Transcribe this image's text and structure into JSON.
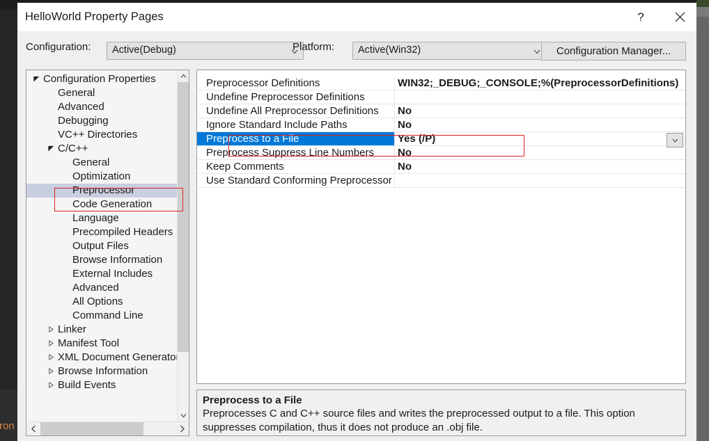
{
  "backdrop": {
    "edge_text": "ron"
  },
  "window": {
    "title": "HelloWorld Property Pages",
    "help_icon": "question-mark-icon",
    "close_icon": "close-icon"
  },
  "toolbar": {
    "configuration_label": "Configuration:",
    "configuration_value": "Active(Debug)",
    "platform_label": "Platform:",
    "platform_value": "Active(Win32)",
    "configuration_manager_label": "Configuration Manager...",
    "chevron_icon": "chevron-down-icon"
  },
  "tree": {
    "nodes": [
      {
        "label": "Configuration Properties",
        "indent": 0,
        "state": "expanded",
        "selected": false
      },
      {
        "label": "General",
        "indent": 1,
        "state": "leaf",
        "selected": false
      },
      {
        "label": "Advanced",
        "indent": 1,
        "state": "leaf",
        "selected": false
      },
      {
        "label": "Debugging",
        "indent": 1,
        "state": "leaf",
        "selected": false
      },
      {
        "label": "VC++ Directories",
        "indent": 1,
        "state": "leaf",
        "selected": false
      },
      {
        "label": "C/C++",
        "indent": 1,
        "state": "expanded",
        "selected": false
      },
      {
        "label": "General",
        "indent": 2,
        "state": "leaf",
        "selected": false
      },
      {
        "label": "Optimization",
        "indent": 2,
        "state": "leaf",
        "selected": false
      },
      {
        "label": "Preprocessor",
        "indent": 2,
        "state": "leaf",
        "selected": true
      },
      {
        "label": "Code Generation",
        "indent": 2,
        "state": "leaf",
        "selected": false
      },
      {
        "label": "Language",
        "indent": 2,
        "state": "leaf",
        "selected": false
      },
      {
        "label": "Precompiled Headers",
        "indent": 2,
        "state": "leaf",
        "selected": false
      },
      {
        "label": "Output Files",
        "indent": 2,
        "state": "leaf",
        "selected": false
      },
      {
        "label": "Browse Information",
        "indent": 2,
        "state": "leaf",
        "selected": false
      },
      {
        "label": "External Includes",
        "indent": 2,
        "state": "leaf",
        "selected": false
      },
      {
        "label": "Advanced",
        "indent": 2,
        "state": "leaf",
        "selected": false
      },
      {
        "label": "All Options",
        "indent": 2,
        "state": "leaf",
        "selected": false
      },
      {
        "label": "Command Line",
        "indent": 2,
        "state": "leaf",
        "selected": false
      },
      {
        "label": "Linker",
        "indent": 1,
        "state": "collapsed",
        "selected": false
      },
      {
        "label": "Manifest Tool",
        "indent": 1,
        "state": "collapsed",
        "selected": false
      },
      {
        "label": "XML Document Generator",
        "indent": 1,
        "state": "collapsed",
        "selected": false
      },
      {
        "label": "Browse Information",
        "indent": 1,
        "state": "collapsed",
        "selected": false
      },
      {
        "label": "Build Events",
        "indent": 1,
        "state": "collapsed",
        "selected": false
      }
    ],
    "scroll_up_icon": "chevron-up-icon",
    "scroll_down_icon": "chevron-down-icon",
    "scroll_left_icon": "chevron-left-icon",
    "scroll_right_icon": "chevron-right-icon"
  },
  "grid": {
    "rows": [
      {
        "name": "Preprocessor Definitions",
        "value": "WIN32;_DEBUG;_CONSOLE;%(PreprocessorDefinitions)",
        "selected": false
      },
      {
        "name": "Undefine Preprocessor Definitions",
        "value": "",
        "selected": false
      },
      {
        "name": "Undefine All Preprocessor Definitions",
        "value": "No",
        "selected": false
      },
      {
        "name": "Ignore Standard Include Paths",
        "value": "No",
        "selected": false
      },
      {
        "name": "Preprocess to a File",
        "value": "Yes (/P)",
        "selected": true
      },
      {
        "name": "Preprocess Suppress Line Numbers",
        "value": "No",
        "selected": false
      },
      {
        "name": "Keep Comments",
        "value": "No",
        "selected": false
      },
      {
        "name": "Use Standard Conforming Preprocessor",
        "value": "",
        "selected": false
      }
    ],
    "dropdown_icon": "chevron-down-icon"
  },
  "description": {
    "title": "Preprocess to a File",
    "body": "Preprocesses C and C++ source files and writes the preprocessed output to a file. This option suppresses compilation, thus it does not produce an .obj file."
  },
  "annotations": {
    "color": "#e02020",
    "highlight_tree_item": "Preprocessor",
    "highlight_grid_row": "Preprocess to a File"
  },
  "colors": {
    "selection_blue": "#0078d7",
    "tree_selection": "#c8cfe0",
    "dialog_background": "#efeff0",
    "desktop_background": "#666666"
  }
}
